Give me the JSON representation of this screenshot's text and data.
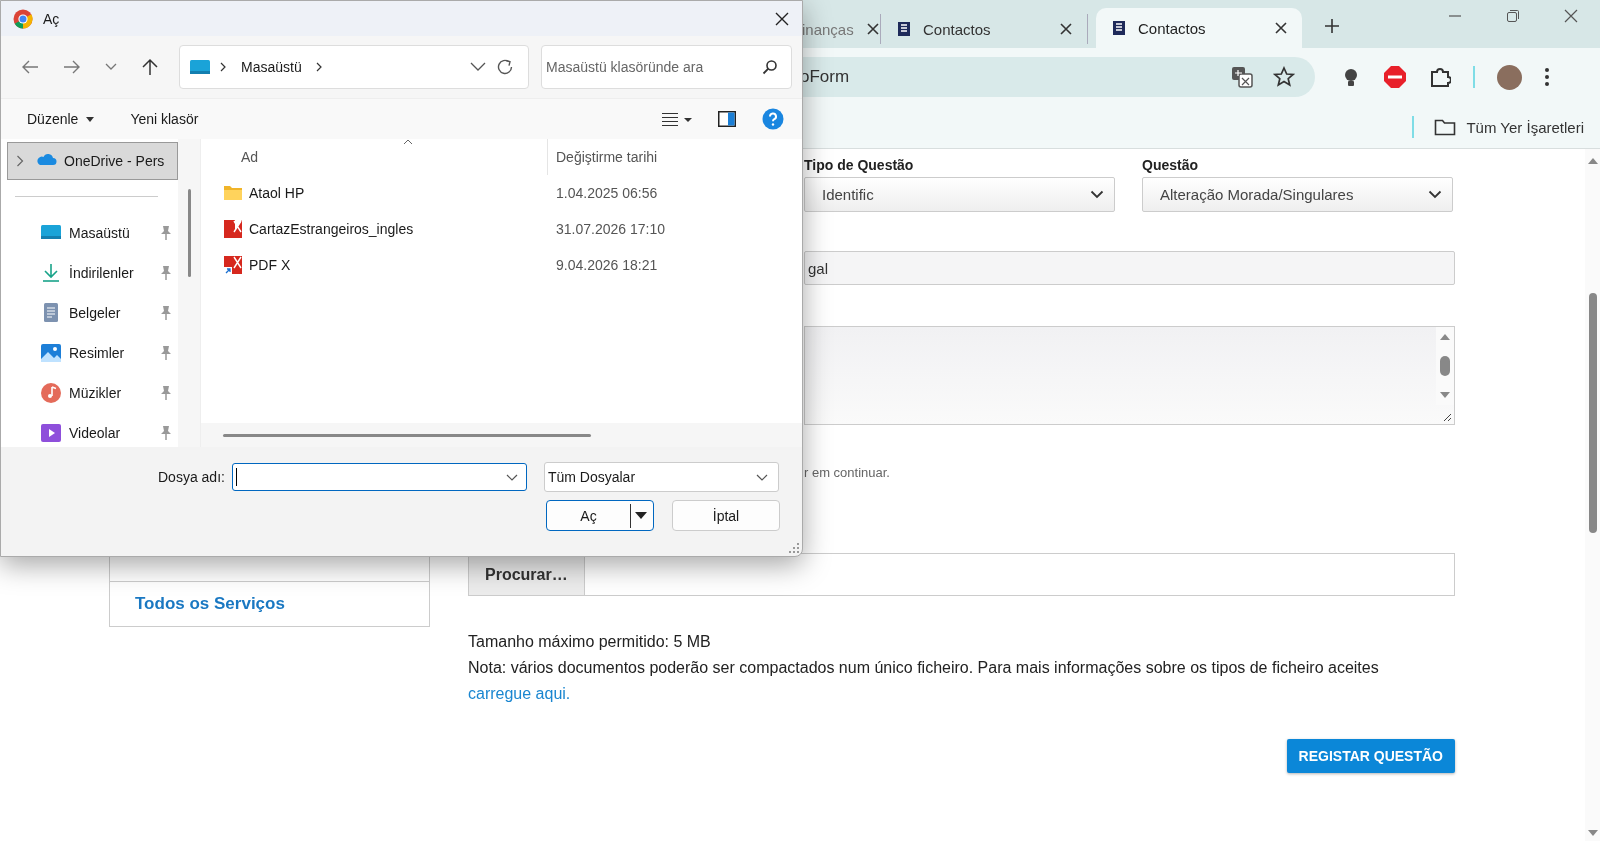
{
  "browser": {
    "tabs": [
      {
        "title": "inanças",
        "selected": false
      },
      {
        "title": "Contactos",
        "selected": false
      },
      {
        "title": "Contactos",
        "selected": true
      }
    ],
    "address": "oForm",
    "bookmarks": [
      {
        "label": "Tüm Yer İşaretleri"
      }
    ]
  },
  "page": {
    "sidebar_links": [
      "Todos os Serviços"
    ],
    "fields": [
      {
        "label": "Tipo de Questão",
        "value": "Identific"
      },
      {
        "label": "Questão",
        "value": "Alteração Morada/Singulares"
      }
    ],
    "text_value": "gal",
    "consent_text": "r em continuar.",
    "browse_button": "Procurar…",
    "size_note": "Tamanho máximo permitido: 5 MB",
    "note": "Nota: vários documentos poderão ser compactados num único ficheiro. Para mais informações sobre os tipos de ficheiro aceites ",
    "note_link": "carregue aqui.",
    "submit": "REGISTAR QUESTÃO"
  },
  "dialog": {
    "title": "Aç",
    "breadcrumb": [
      "Masaüstü"
    ],
    "search": {
      "placeholder": "Masaüstü klasöründe ara"
    },
    "toolbar": [
      {
        "label": "Düzenle",
        "menu": true
      },
      {
        "label": "Yeni klasör",
        "menu": false
      }
    ],
    "nav_items": [
      {
        "label": "OneDrive - Pers",
        "kind": "cloud",
        "selected": true,
        "pinned": false
      },
      {
        "label": "Masaüstü",
        "kind": "desktop",
        "selected": false,
        "pinned": true
      },
      {
        "label": "İndirilenler",
        "kind": "download",
        "selected": false,
        "pinned": true
      },
      {
        "label": "Belgeler",
        "kind": "document",
        "selected": false,
        "pinned": true
      },
      {
        "label": "Resimler",
        "kind": "picture",
        "selected": false,
        "pinned": true
      },
      {
        "label": "Müzikler",
        "kind": "music",
        "selected": false,
        "pinned": true
      },
      {
        "label": "Videolar",
        "kind": "video",
        "selected": false,
        "pinned": true
      }
    ],
    "columns": [
      "Ad",
      "Değiştirme tarihi"
    ],
    "files": [
      {
        "name": "Ataol HP",
        "date": "1.04.2025 06:56",
        "kind": "folder"
      },
      {
        "name": "CartazEstrangeiros_ingles",
        "date": "31.07.2026 17:10",
        "kind": "pdf"
      },
      {
        "name": "PDF X",
        "date": "9.04.2026 18:21",
        "kind": "pdf-shortcut"
      }
    ],
    "filename_label": "Dosya adı:",
    "filter": "Tüm Dosyalar",
    "buttons": [
      {
        "label": "Aç",
        "kind": "split"
      },
      {
        "label": "İptal",
        "kind": "plain"
      }
    ]
  }
}
